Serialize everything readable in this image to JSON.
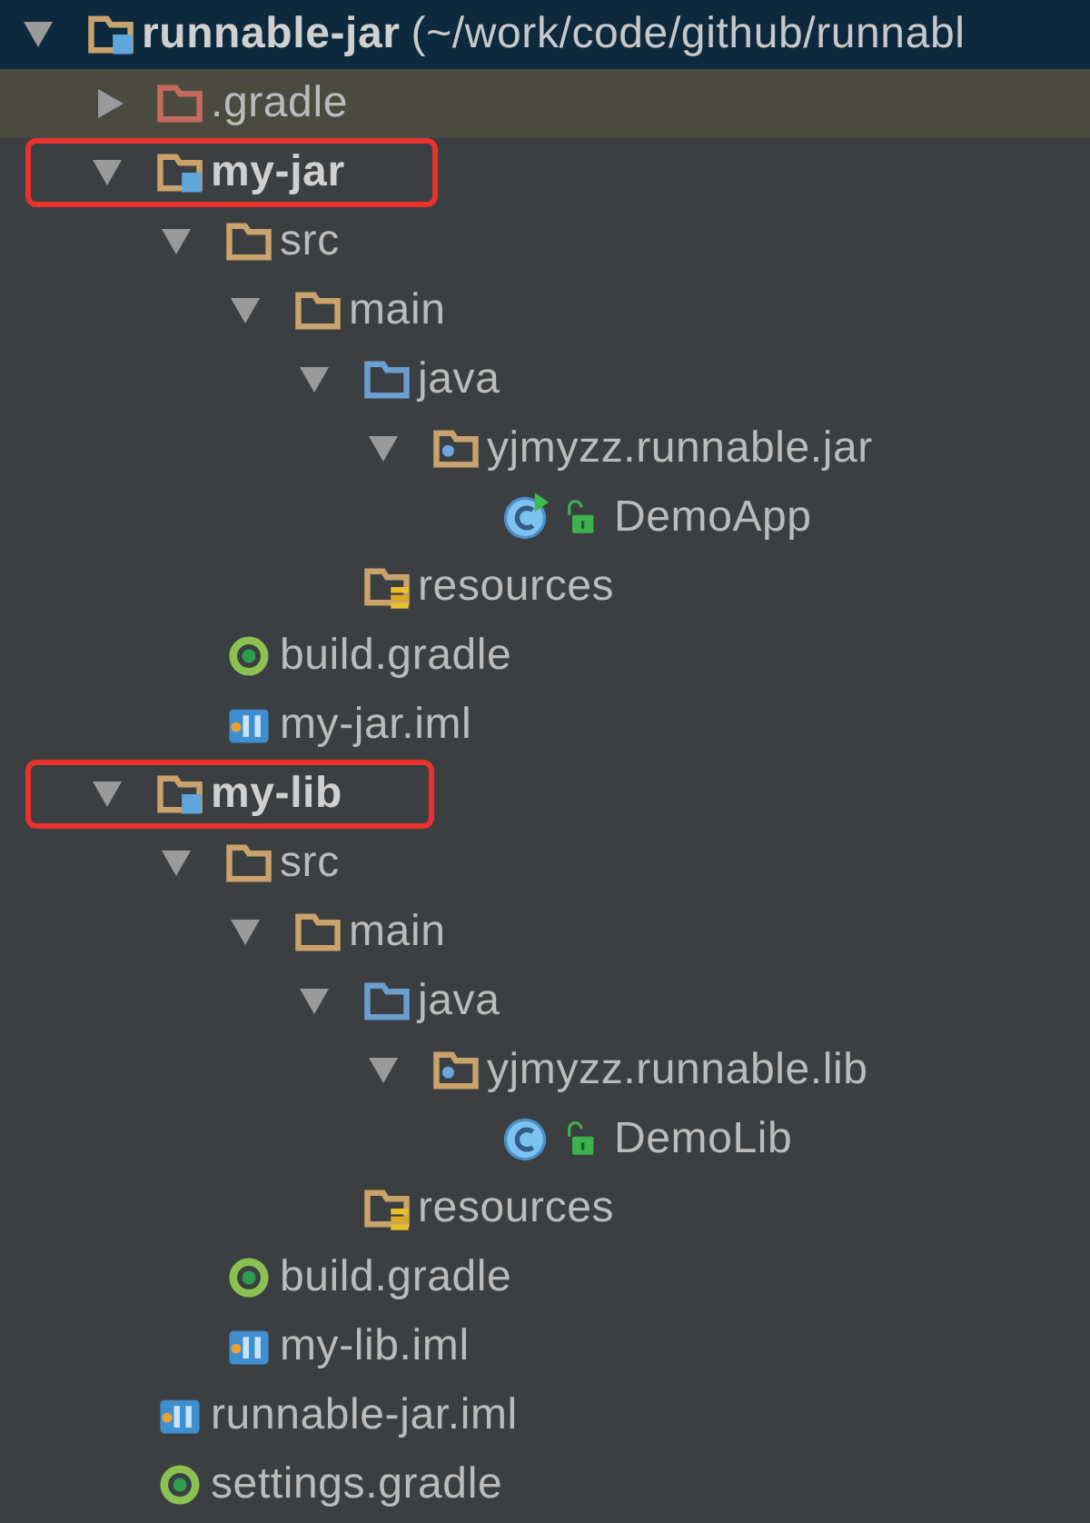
{
  "tree": {
    "name": "runnable-jar",
    "detail": "(~/work/code/github/runnabl",
    "kind": "module",
    "expanded": true,
    "selected": true,
    "hovered": false,
    "annotated": false,
    "children": [
      {
        "name": ".gradle",
        "kind": "excluded",
        "expanded": false,
        "selected": false,
        "hovered": true,
        "annotated": false
      },
      {
        "name": "my-jar",
        "kind": "module",
        "expanded": true,
        "selected": false,
        "hovered": false,
        "annotated": true,
        "children": [
          {
            "name": "src",
            "kind": "folder",
            "expanded": true,
            "selected": false,
            "hovered": false,
            "annotated": false,
            "children": [
              {
                "name": "main",
                "kind": "folder",
                "expanded": true,
                "selected": false,
                "hovered": false,
                "annotated": false,
                "children": [
                  {
                    "name": "java",
                    "kind": "source",
                    "expanded": true,
                    "selected": false,
                    "hovered": false,
                    "annotated": false,
                    "children": [
                      {
                        "name": "yjmyzz.runnable.jar",
                        "kind": "package",
                        "expanded": true,
                        "selected": false,
                        "hovered": false,
                        "annotated": false,
                        "children": [
                          {
                            "name": "DemoApp",
                            "kind": "class",
                            "runnable": true,
                            "selected": false,
                            "hovered": false,
                            "annotated": false
                          }
                        ]
                      }
                    ]
                  },
                  {
                    "name": "resources",
                    "kind": "resources",
                    "selected": false,
                    "hovered": false,
                    "annotated": false
                  }
                ]
              }
            ]
          },
          {
            "name": "build.gradle",
            "kind": "gradle",
            "selected": false,
            "hovered": false,
            "annotated": false
          },
          {
            "name": "my-jar.iml",
            "kind": "iml",
            "selected": false,
            "hovered": false,
            "annotated": false
          }
        ]
      },
      {
        "name": "my-lib",
        "kind": "module",
        "expanded": true,
        "selected": false,
        "hovered": false,
        "annotated": true,
        "children": [
          {
            "name": "src",
            "kind": "folder",
            "expanded": true,
            "selected": false,
            "hovered": false,
            "annotated": false,
            "children": [
              {
                "name": "main",
                "kind": "folder",
                "expanded": true,
                "selected": false,
                "hovered": false,
                "annotated": false,
                "children": [
                  {
                    "name": "java",
                    "kind": "source",
                    "expanded": true,
                    "selected": false,
                    "hovered": false,
                    "annotated": false,
                    "children": [
                      {
                        "name": "yjmyzz.runnable.lib",
                        "kind": "package",
                        "expanded": true,
                        "selected": false,
                        "hovered": false,
                        "annotated": false,
                        "children": [
                          {
                            "name": "DemoLib",
                            "kind": "class",
                            "runnable": false,
                            "selected": false,
                            "hovered": false,
                            "annotated": false
                          }
                        ]
                      }
                    ]
                  },
                  {
                    "name": "resources",
                    "kind": "resources",
                    "selected": false,
                    "hovered": false,
                    "annotated": false
                  }
                ]
              }
            ]
          },
          {
            "name": "build.gradle",
            "kind": "gradle",
            "selected": false,
            "hovered": false,
            "annotated": false
          },
          {
            "name": "my-lib.iml",
            "kind": "iml",
            "selected": false,
            "hovered": false,
            "annotated": false
          }
        ]
      },
      {
        "name": "runnable-jar.iml",
        "kind": "iml",
        "selected": false,
        "hovered": false,
        "annotated": false
      },
      {
        "name": "settings.gradle",
        "kind": "gradle",
        "selected": false,
        "hovered": false,
        "annotated": false
      }
    ]
  }
}
